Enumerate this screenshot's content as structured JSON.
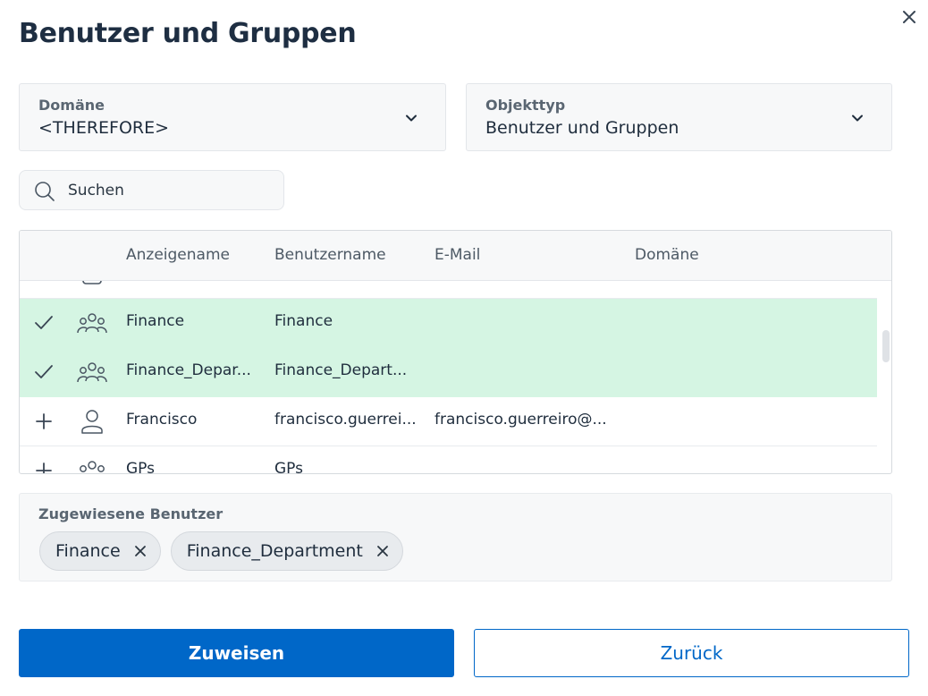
{
  "dialog": {
    "title": "Benutzer und Gruppen",
    "close_icon": "close-icon"
  },
  "filters": {
    "domain": {
      "label": "Domäne",
      "value": "<THEREFORE>"
    },
    "object_type": {
      "label": "Objekttyp",
      "value": "Benutzer und Gruppen"
    }
  },
  "search": {
    "placeholder": "Suchen",
    "value": ""
  },
  "table": {
    "columns": [
      "Anzeigename",
      "Benutzername",
      "E-Mail",
      "Domäne"
    ],
    "rows": [
      {
        "action": "check",
        "type": "group",
        "display_name": "Finance",
        "username": "Finance",
        "email": "",
        "domain": "",
        "selected": true
      },
      {
        "action": "check",
        "type": "group",
        "display_name": "Finance_Depar...",
        "username": "Finance_Depart...",
        "email": "",
        "domain": "",
        "selected": true
      },
      {
        "action": "add",
        "type": "user",
        "display_name": "Francisco",
        "username": "francisco.guerrei...",
        "email": "francisco.guerreiro@...",
        "domain": "",
        "selected": false
      },
      {
        "action": "add",
        "type": "group",
        "display_name": "GPs",
        "username": "GPs",
        "email": "",
        "domain": "",
        "selected": false
      }
    ]
  },
  "assigned": {
    "label": "Zugewiesene Benutzer",
    "chips": [
      "Finance",
      "Finance_Department"
    ]
  },
  "actions": {
    "assign_label": "Zuweisen",
    "back_label": "Zurück"
  },
  "colors": {
    "primary": "#0067c8",
    "selected_row": "#d5f5e3",
    "title": "#1e2e42"
  }
}
